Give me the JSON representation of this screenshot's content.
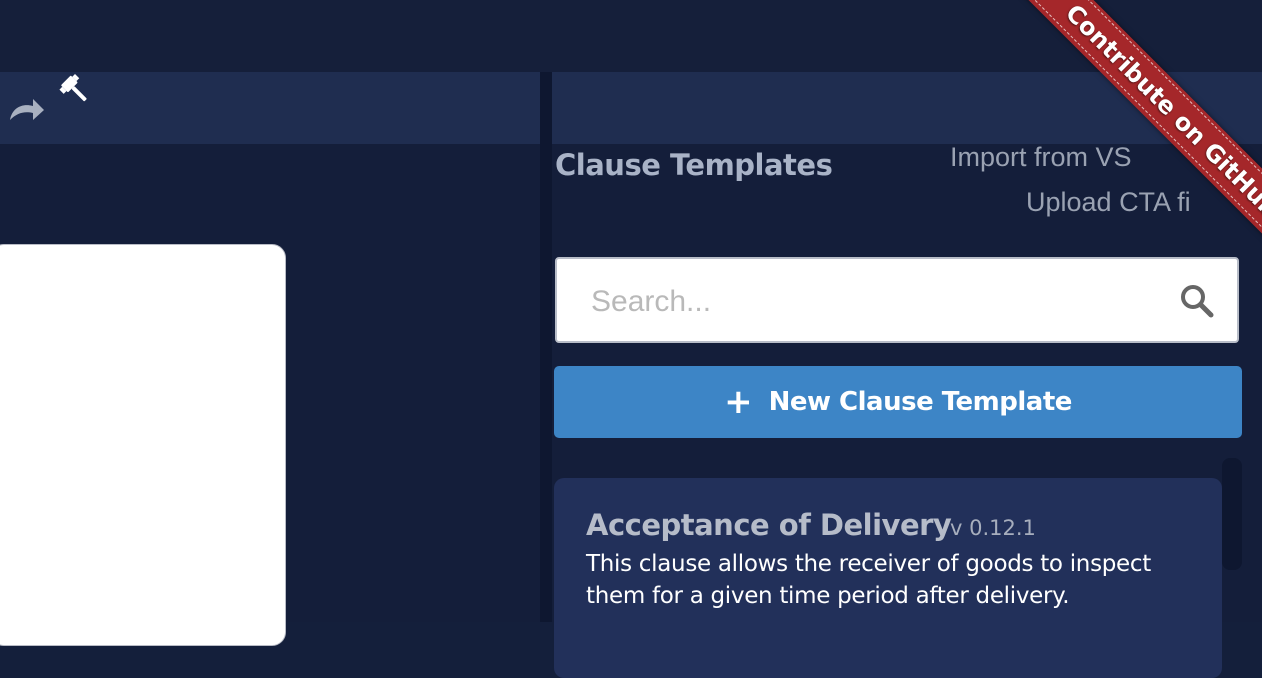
{
  "toolbar": {
    "redo_icon": "redo-icon",
    "gavel_icon": "gavel-icon"
  },
  "panel": {
    "title": "Clause Templates",
    "import_link": "Import from VS",
    "upload_link": "Upload CTA fi"
  },
  "search": {
    "placeholder": "Search...",
    "icon": "search-icon"
  },
  "new_button": {
    "icon": "plus-icon",
    "label": "New Clause Template"
  },
  "templates": [
    {
      "name": "Acceptance of Delivery",
      "version": "v 0.12.1",
      "description": "This clause allows the receiver of goods to inspect them for a given time period after delivery."
    }
  ],
  "ribbon": {
    "label": "Contribute on GitHub",
    "color": "#a5272a"
  },
  "colors": {
    "background": "#141e3a",
    "toolbar": "#1f2d50",
    "accent": "#3d85c6"
  }
}
